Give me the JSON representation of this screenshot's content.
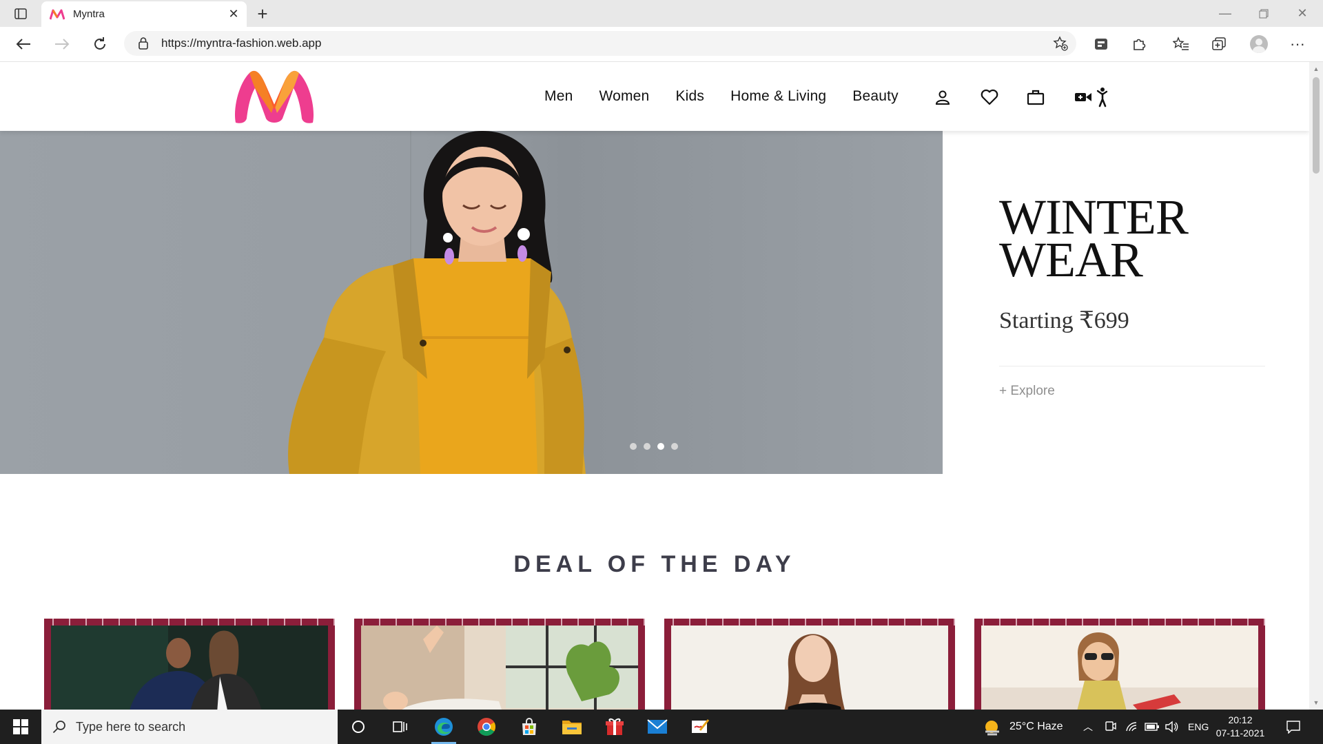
{
  "browser": {
    "tab_title": "Myntra",
    "url": "https://myntra-fashion.web.app"
  },
  "site": {
    "nav": [
      "Men",
      "Women",
      "Kids",
      "Home & Living",
      "Beauty"
    ]
  },
  "hero": {
    "title_line1": "WINTER",
    "title_line2": "WEAR",
    "subtitle": "Starting ₹699",
    "explore": "+ Explore",
    "slides_total": 4,
    "active_slide": 3
  },
  "deal": {
    "title": "DEAL OF THE DAY"
  },
  "taskbar": {
    "search_placeholder": "Type here to search",
    "weather": "25°C  Haze",
    "language": "ENG",
    "time": "20:12",
    "date": "07-11-2021"
  },
  "colors": {
    "myntra_pink": "#ee3d8f",
    "myntra_orange": "#f58025",
    "deal_border": "#8b1e3a",
    "jacket_yellow": "#d9a72c"
  }
}
